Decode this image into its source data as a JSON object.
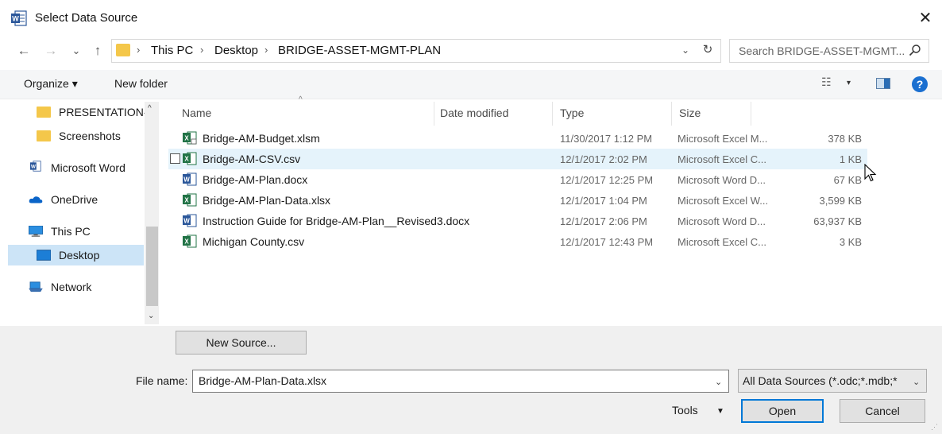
{
  "window": {
    "title": "Select Data Source",
    "close": "✕",
    "app_icon": "word-app-icon"
  },
  "nav": {
    "back": "←",
    "forward": "→",
    "recent": "⌄",
    "up": "↑",
    "breadcrumb": [
      "This PC",
      "Desktop",
      "BRIDGE-ASSET-MGMT-PLAN"
    ],
    "separator": "›",
    "refresh": "↻",
    "dropdown": "⌄",
    "search_placeholder": "Search BRIDGE-ASSET-MGMT..."
  },
  "toolbar": {
    "organize": "Organize ▾",
    "new_folder": "New folder",
    "view_icon": "☷",
    "view_down": "▾",
    "help": "?"
  },
  "sidebar": {
    "items": [
      {
        "label": "PRESENTATION-",
        "icon": "folder-icon"
      },
      {
        "label": "Screenshots",
        "icon": "folder-icon"
      },
      {
        "label": "Microsoft Word",
        "icon": "word-icon"
      },
      {
        "label": "OneDrive",
        "icon": "cloud-icon"
      },
      {
        "label": "This PC",
        "icon": "computer-icon"
      },
      {
        "label": "Desktop",
        "icon": "desktop-icon"
      },
      {
        "label": "Network",
        "icon": "network-icon"
      }
    ],
    "scroll_up": "^",
    "scroll_down": "⌄"
  },
  "columns": {
    "name": "Name",
    "date": "Date modified",
    "type": "Type",
    "size": "Size"
  },
  "files": [
    {
      "name": "Bridge-AM-Budget.xlsm",
      "date": "11/30/2017 1:12 PM",
      "type": "Microsoft Excel M...",
      "size": "378 KB",
      "icon": "excel-macro-icon"
    },
    {
      "name": "Bridge-AM-CSV.csv",
      "date": "12/1/2017 2:02 PM",
      "type": "Microsoft Excel C...",
      "size": "1 KB",
      "icon": "excel-csv-icon"
    },
    {
      "name": "Bridge-AM-Plan.docx",
      "date": "12/1/2017 12:25 PM",
      "type": "Microsoft Word D...",
      "size": "67 KB",
      "icon": "word-doc-icon"
    },
    {
      "name": "Bridge-AM-Plan-Data.xlsx",
      "date": "12/1/2017 1:04 PM",
      "type": "Microsoft Excel W...",
      "size": "3,599 KB",
      "icon": "excel-icon"
    },
    {
      "name": "Instruction Guide for Bridge-AM-Plan__Revised3.docx",
      "date": "12/1/2017 2:06 PM",
      "type": "Microsoft Word D...",
      "size": "63,937 KB",
      "icon": "word-doc-icon"
    },
    {
      "name": "Michigan County.csv",
      "date": "12/1/2017 12:43 PM",
      "type": "Microsoft Excel C...",
      "size": "3 KB",
      "icon": "excel-csv-icon"
    }
  ],
  "bottom": {
    "new_source": "New Source...",
    "file_name_label": "File name:",
    "file_name_value": "Bridge-AM-Plan-Data.xlsx",
    "filter": "All Data Sources (*.odc;*.mdb;*",
    "tools": "Tools",
    "open": "Open",
    "cancel": "Cancel"
  },
  "colors": {
    "word_blue": "#2b579a",
    "excel_green": "#217346",
    "folder_yellow": "#f4c74a",
    "selection": "#cce4f7",
    "hover": "#e5f3fb",
    "accent": "#0078d7"
  }
}
